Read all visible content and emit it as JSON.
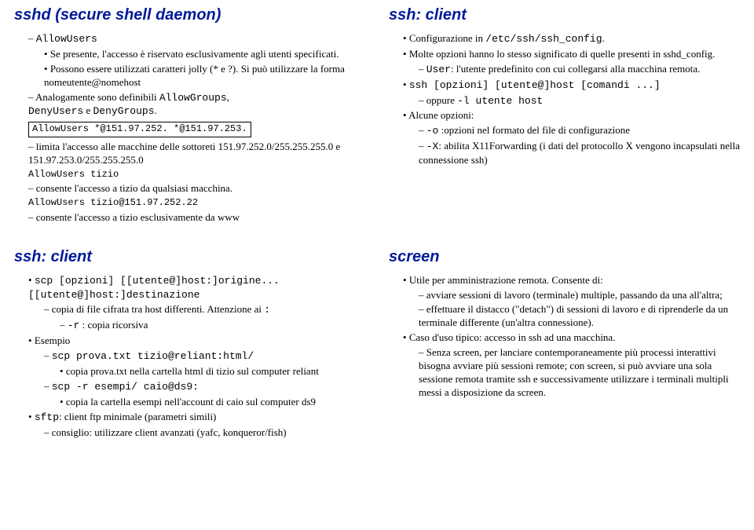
{
  "top": {
    "left": {
      "title": "sshd (secure shell daemon)",
      "l1_dash": "AllowUsers",
      "l1_b1": "Se presente, l'accesso è riservato esclusivamente agli utenti specificati.",
      "l1_b2": "Possono essere utilizzati caratteri jolly (* e ?). Si può utilizzare la forma nomeutente@nomehost",
      "l2_dash": "Analogamente sono definibili ",
      "l2_code": "AllowGroups",
      "l2_tail": ", ",
      "l2_line2a": "DenyUsers",
      "l2_line2b": " e ",
      "l2_line2c": "DenyGroups",
      "l2_line2d": ".",
      "box": "AllowUsers *@151.97.252. *@151.97.253.",
      "l3_dash": "limita l'accesso alle macchine delle sottoreti 151.97.252.0/255.255.255.0 e 151.97.253.0/255.255.255.0",
      "code2": "AllowUsers tizio",
      "l4_dash": "consente l'accesso a tizio da qualsiasi macchina.",
      "code3": "AllowUsers tizio@151.97.252.22",
      "l5_dash": "consente l'accesso a tizio esclusivamente da www"
    },
    "right": {
      "title": "ssh: client",
      "b1a": "Configurazione in ",
      "b1b": "/etc/ssh/ssh_config",
      "b1c": ".",
      "b2": "Molte opzioni hanno lo stesso significato di quelle presenti in sshd_config.",
      "b2_sub_a": "User",
      "b2_sub_b": ": l'utente predefinito con cui collegarsi alla macchina remota.",
      "b3": "ssh [opzioni] [utente@]host [comandi ...]",
      "b3_sub_a": "oppure ",
      "b3_sub_b": "-l utente host",
      "b4": "Alcune opzioni:",
      "b4_s1a": "-o",
      "b4_s1b": " :opzioni nel formato del file di configurazione",
      "b4_s2a": "-X",
      "b4_s2b": ": abilita X11Forwarding (i dati del protocollo X vengono incapsulati nella connessione ssh)"
    }
  },
  "bottom": {
    "left": {
      "title": "ssh: client",
      "b1a": "scp [opzioni] [[utente@]host:]origine... [[utente@]host:]destinazione",
      "b1_s1": "copia di file cifrata tra host differenti. Attenzione ai ",
      "b1_s1_colon": ":",
      "b1_s2a": "-r",
      "b1_s2b": " : copia ricorsiva",
      "b2": "Esempio",
      "b2_s1": "scp prova.txt tizio@reliant:html/",
      "b2_s1_sub": "copia prova.txt nella cartella html di tizio sul computer reliant",
      "b2_s2": "scp -r esempi/ caio@ds9:",
      "b2_s2_sub": "copia la cartella esempi nell'account di caio sul computer ds9",
      "b3a": "sftp",
      "b3b": ": client ftp minimale (parametri simili)",
      "b3_s1": "consiglio: utilizzare client avanzati (yafc, konqueror/fish)"
    },
    "right": {
      "title": "screen",
      "b1": "Utile per amministrazione remota. Consente di:",
      "b1_s1": "avviare sessioni di lavoro (terminale) multiple, passando da una all'altra;",
      "b1_s2": "effettuare il distacco (\"detach\") di sessioni di lavoro e di riprenderle da un terminale differente (un'altra connessione).",
      "b2": "Caso d'uso tipico: accesso in ssh ad una macchina.",
      "b2_s1": "Senza screen, per lanciare contemporaneamente più processi interattivi bisogna avviare più sessioni remote; con screen, si può avviare una sola sessione remota tramite ssh e successivamente utilizzare i terminali multipli messi a disposizione da screen."
    }
  }
}
